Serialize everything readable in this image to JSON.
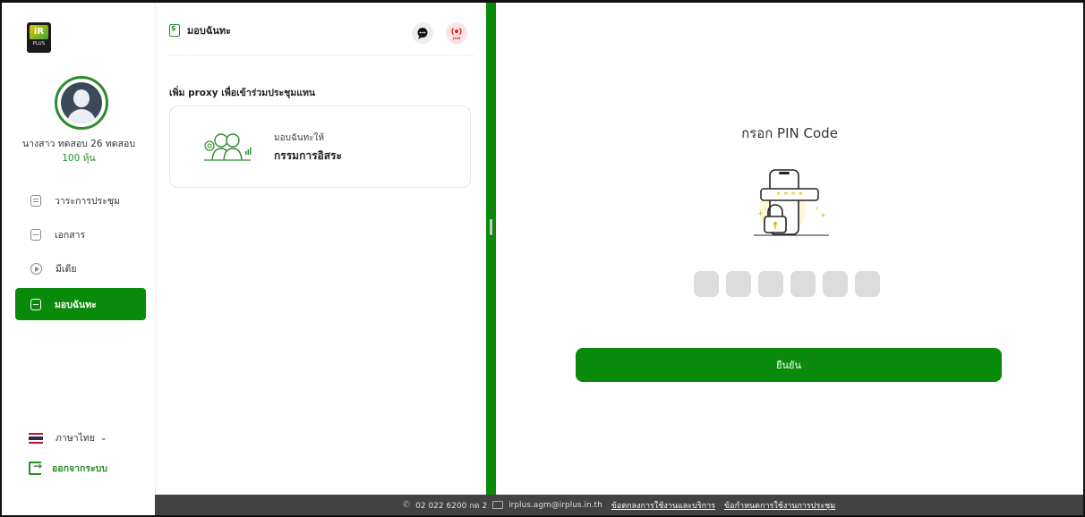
{
  "sidebar": {
    "logo": {
      "mark": "iR",
      "sub": "PLUS"
    },
    "user": {
      "name": "นางสาว ทดสอบ 26 ทดสอบ",
      "shares": "100 หุ้น"
    },
    "items": [
      {
        "label": "วาระการประชุม",
        "icon": "agenda-icon"
      },
      {
        "label": "เอกสาร",
        "icon": "document-icon"
      },
      {
        "label": "มีเดีย",
        "icon": "media-play-icon"
      },
      {
        "label": "มอบฉันทะ",
        "icon": "proxy-document-icon",
        "active": true
      }
    ],
    "language": "ภาษาไทย",
    "logout": "ออกจากระบบ"
  },
  "middle": {
    "title": "มอบฉันทะ",
    "live_label": "LIVE",
    "proxy_heading": "เพิ่ม proxy เพื่อเข้าร่วมประชุมแทน",
    "card": {
      "subtitle": "มอบฉันทะให้",
      "title": "กรรมการอิสระ"
    }
  },
  "right": {
    "pin_title": "กรอก PIN Code",
    "pin_length": 6,
    "confirm_label": "ยืนยัน"
  },
  "footer": {
    "phone": "02 022 6200 กด 2",
    "email": "irplus.agm@irplus.in.th",
    "terms_link": "ข้อตกลงการใช้งานและบริการ",
    "meeting_terms_link": "ข้อกำหนดการใช้งานการประชุม"
  },
  "colors": {
    "primary_green": "#0a8a0a",
    "live_red": "#e0222a",
    "footer_bg": "#424242"
  }
}
